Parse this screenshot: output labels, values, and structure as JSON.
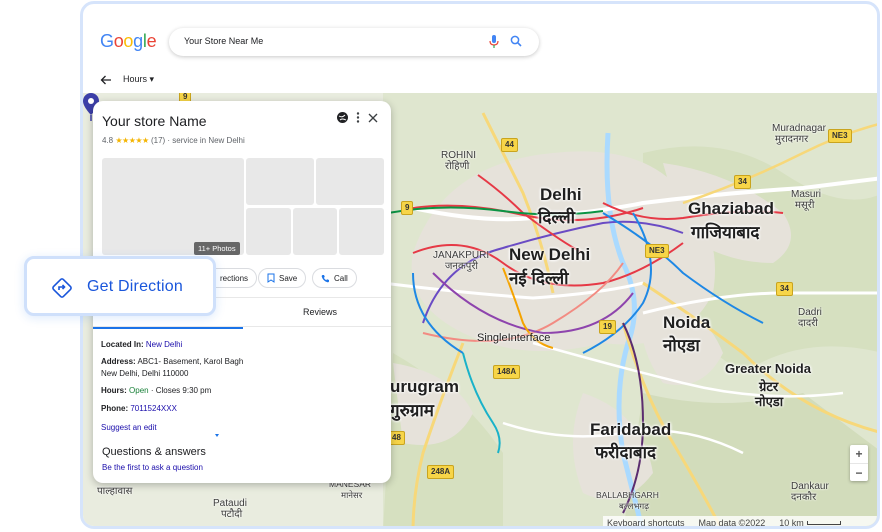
{
  "search": {
    "logo_letters": [
      "G",
      "o",
      "o",
      "g",
      "l",
      "e"
    ],
    "logo_colors": [
      "#4285f4",
      "#ea4335",
      "#fbbc05",
      "#4285f4",
      "#34a853",
      "#ea4335"
    ],
    "query": "Your Store Near Me",
    "mic_icon": "mic-icon",
    "search_icon": "search-icon"
  },
  "filters": {
    "back_icon": "arrow-left-icon",
    "hours_label": "Hours ▾"
  },
  "panel": {
    "store_name": "Your store Name",
    "rating_value": "4.8",
    "rating_stars": "★★★★★",
    "rating_count": "(17)",
    "category": "· service in New Delhi",
    "photo_count": "11+ Photos",
    "actions": {
      "directions": "rections",
      "save": "Save",
      "call": "Call"
    },
    "tabs": {
      "reviews": "Reviews"
    },
    "located_in_label": "Located In:",
    "located_in_value": "New Delhi",
    "address_label": "Address:",
    "address_line1": "ABC1- Basement, Karol Bagh",
    "address_line2": "New Delhi, Delhi 110000",
    "hours_label": "Hours:",
    "hours_status": "Open",
    "hours_close": "· Closes 9:30 pm",
    "phone_label": "Phone:",
    "phone_value": "7011524XXX",
    "suggest_edit": "Suggest an edit",
    "qa_title": "Questions & answers",
    "qa_link": "Be the first to ask a question"
  },
  "callout": {
    "label": "Get Direction",
    "accent": "#1a56db"
  },
  "map": {
    "pin_label": "SingleInterface",
    "cities": {
      "delhi_en": "Delhi",
      "delhi_hi": "दिल्ली",
      "newdelhi_en": "New Delhi",
      "newdelhi_hi": "नई दिल्ली",
      "ghaziabad_en": "Ghaziabad",
      "ghaziabad_hi": "गाजियाबाद",
      "noida_en": "Noida",
      "noida_hi": "नोएडा",
      "gurugram_en": "urugram",
      "gurugram_hi": "गुरुग्राम",
      "faridabad_en": "Faridabad",
      "faridabad_hi": "फरीदाबाद",
      "greaternoida_en": "Greater Noida",
      "greaternoida_hi1": "ग्रेटर",
      "greaternoida_hi2": "नोएडा"
    },
    "towns": {
      "rohini_en": "ROHINI",
      "rohini_hi": "रोहिणी",
      "janakpuri_en": "JANAKPURI",
      "janakpuri_hi": "जनकपुरी",
      "muradnagar_en": "Muradnagar",
      "muradnagar_hi": "मुरादनगर",
      "masuri_en": "Masuri",
      "masuri_hi": "मसूरी",
      "dadri_en": "Dadri",
      "dadri_hi": "दादरी",
      "ballabhgarh_en": "BALLABHGARH",
      "ballabhgarh_hi": "बल्लभगढ़",
      "dankaur_en": "Dankaur",
      "dankaur_hi": "दनकौर",
      "pataudi_en": "Pataudi",
      "pataudi_hi": "पटौदी",
      "manesar_en": "MANESAR",
      "manesar_hi": "मानेसर",
      "palhawas_hi": "पाल्हावास"
    },
    "shields": [
      "9",
      "44",
      "9",
      "NE3",
      "34",
      "NE3",
      "34",
      "19",
      "148A",
      "248A",
      "48"
    ],
    "zoom_in": "+",
    "zoom_out": "−",
    "attribution": {
      "shortcuts": "Keyboard shortcuts",
      "data": "Map data ©2022",
      "scale": "10 km"
    }
  }
}
